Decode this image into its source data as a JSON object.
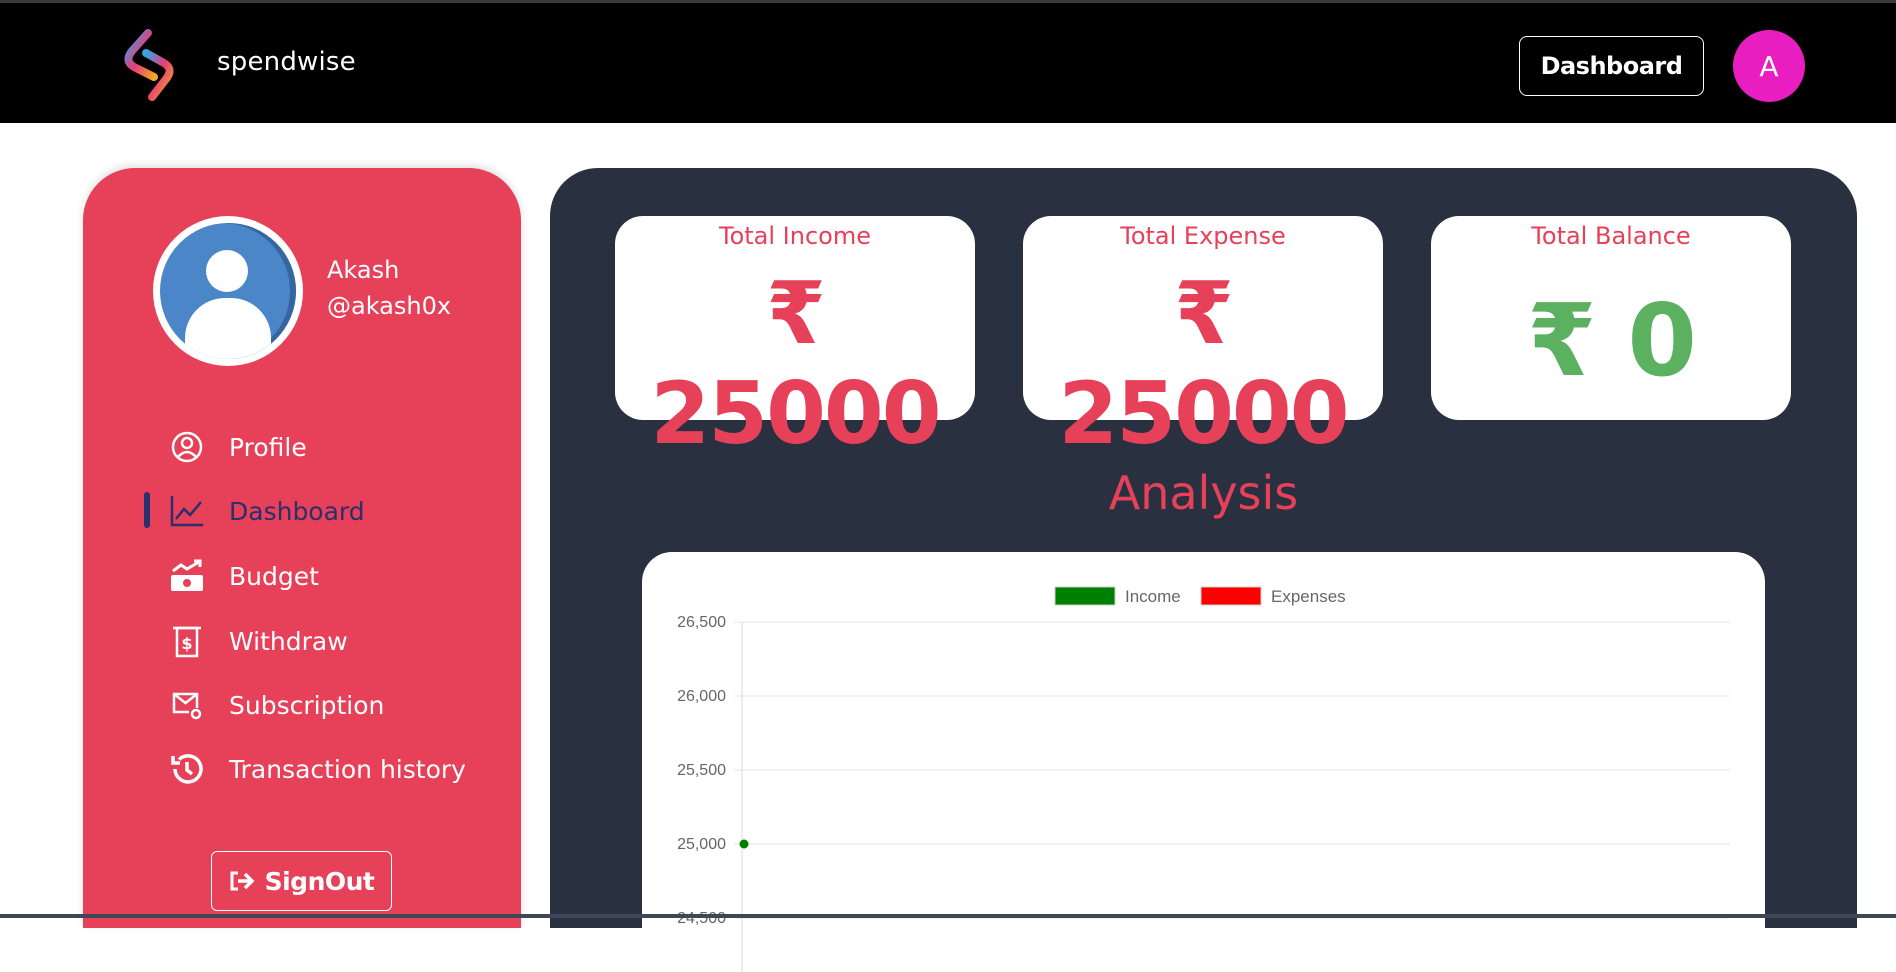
{
  "header": {
    "brand": "spendwise",
    "dashboard_button": "Dashboard",
    "avatar_letter": "A",
    "logo_icon": "spendwise-logo-icon"
  },
  "sidebar": {
    "user": {
      "name": "Akash",
      "handle": "@akash0x",
      "avatar_icon": "user-avatar-icon"
    },
    "items": [
      {
        "label": "Profile",
        "icon": "user-circle-icon",
        "active": false
      },
      {
        "label": "Dashboard",
        "icon": "line-chart-icon",
        "active": true
      },
      {
        "label": "Budget",
        "icon": "money-growth-icon",
        "active": false
      },
      {
        "label": "Withdraw",
        "icon": "withdraw-icon",
        "active": false
      },
      {
        "label": "Subscription",
        "icon": "mail-icon",
        "active": false
      },
      {
        "label": "Transaction history",
        "icon": "history-icon",
        "active": false
      }
    ],
    "signout_label": "SignOut",
    "signout_icon": "sign-out-icon"
  },
  "cards": {
    "income": {
      "title": "Total Income",
      "value": "₹ 25000"
    },
    "expense": {
      "title": "Total Expense",
      "value": "₹ 25000"
    },
    "balance": {
      "title": "Total Balance",
      "value": "₹ 0"
    }
  },
  "analysis": {
    "title": "Analysis"
  },
  "colors": {
    "accent": "#e74059",
    "main_bg": "#293140",
    "balance": "#5cb160",
    "income": "#008000",
    "expenses": "#ff0000"
  },
  "chart_data": {
    "type": "line",
    "series": [
      {
        "name": "Income",
        "color": "#008000",
        "values": [
          25000
        ]
      },
      {
        "name": "Expenses",
        "color": "#ff0000",
        "values": []
      }
    ],
    "y_ticks": [
      "26,500",
      "26,000",
      "25,500",
      "25,000",
      "24,500"
    ],
    "ylim": [
      24500,
      26500
    ],
    "grid": true,
    "legend": "top-center"
  }
}
